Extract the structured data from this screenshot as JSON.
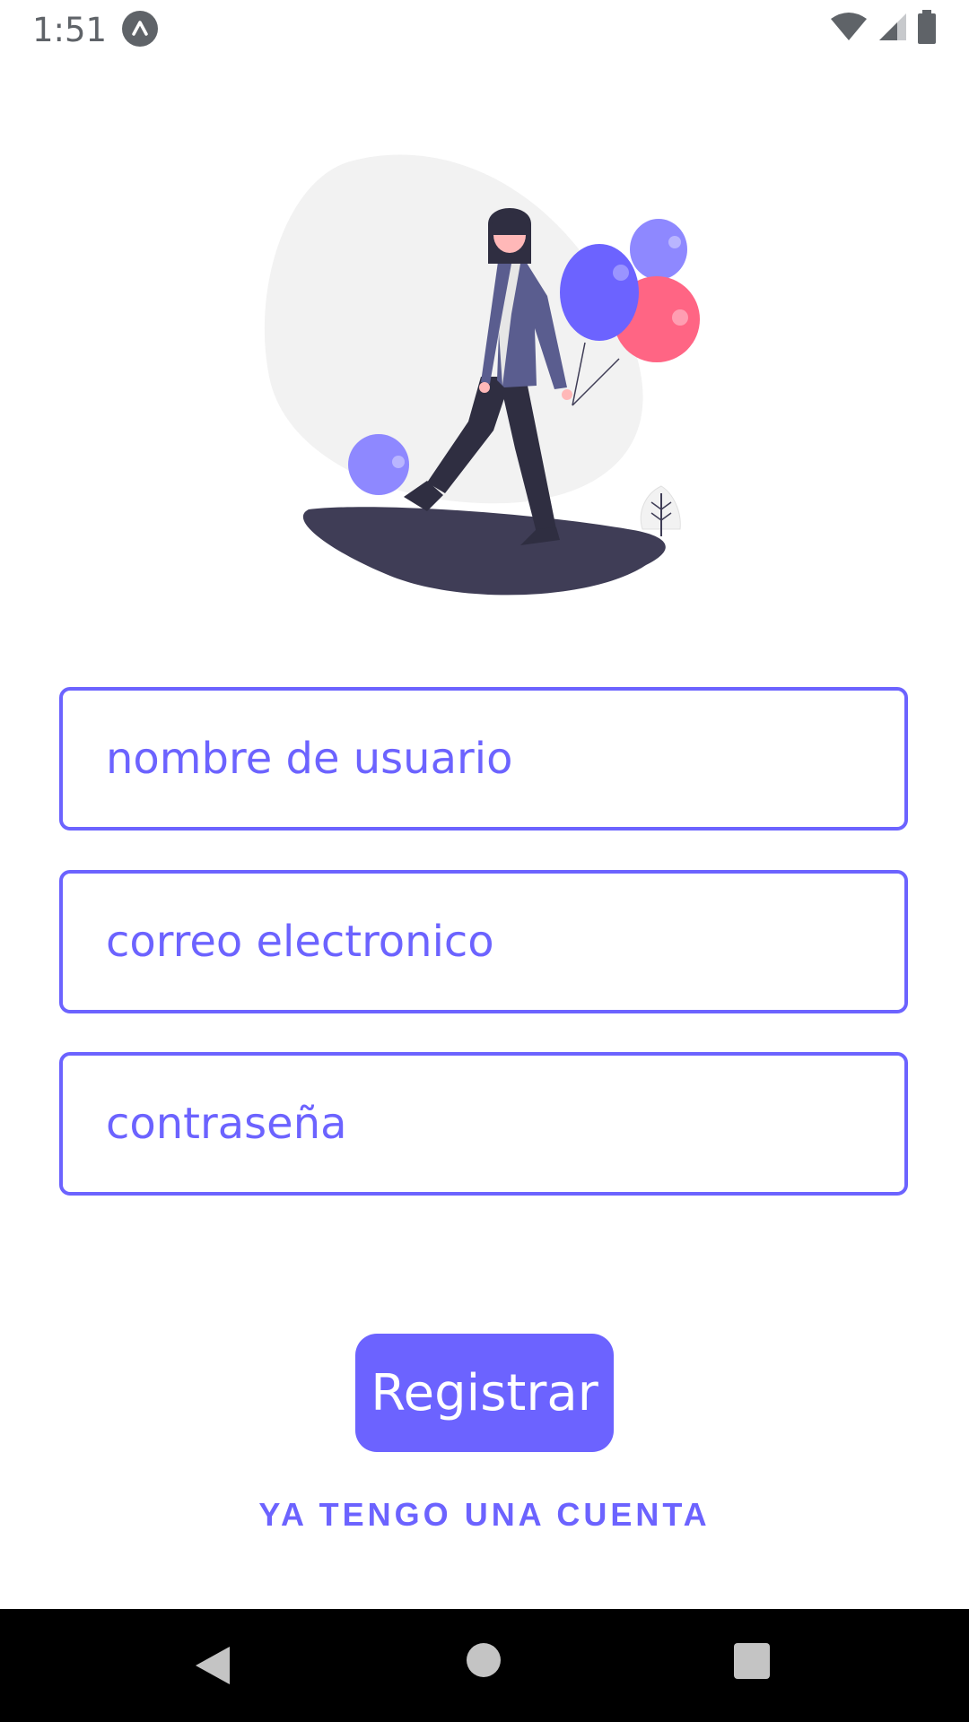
{
  "status_bar": {
    "time": "1:51",
    "icons": [
      "app-notification-icon",
      "wifi-icon",
      "cell-signal-icon",
      "battery-icon"
    ]
  },
  "illustration": {
    "name": "woman-with-balloons",
    "colors": {
      "blob": "#f2f2f2",
      "ground": "#3f3d56",
      "balloon_primary": "#6c63ff",
      "balloon_light": "#8e88ff",
      "balloon_red": "#ff6584",
      "jacket": "#5a5d8f"
    }
  },
  "form": {
    "username_placeholder": "nombre de usuario",
    "email_placeholder": "correo electronico",
    "password_placeholder": "contraseña",
    "register_label": "Registrar",
    "login_link": "YA TENGO UNA CUENTA"
  },
  "theme": {
    "accent": "#6c63ff",
    "background": "#ffffff"
  },
  "nav_bar": {
    "icons": [
      "back-icon",
      "home-icon",
      "recents-icon"
    ]
  }
}
